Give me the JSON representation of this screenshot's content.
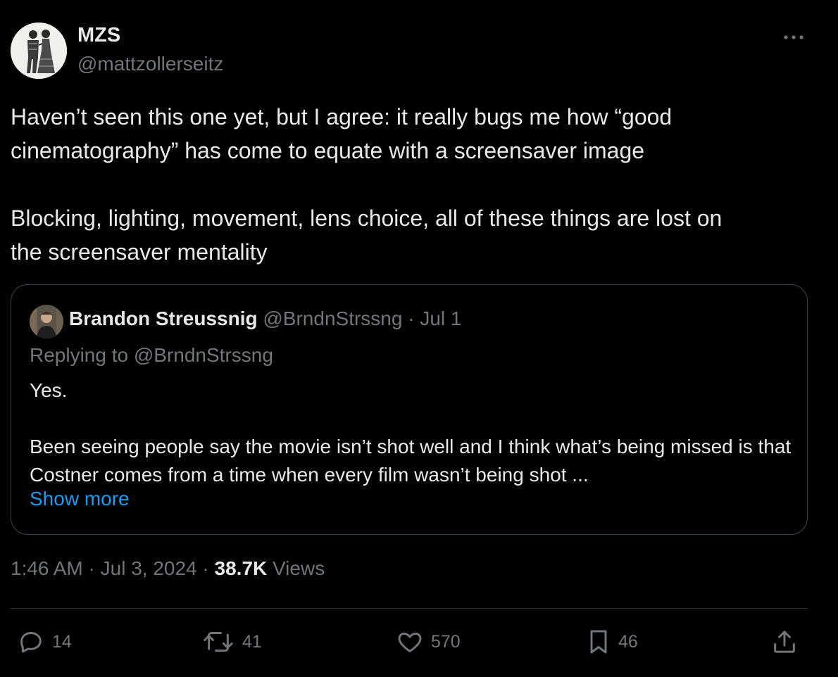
{
  "author": {
    "name": "MZS",
    "handle": "@mattzollerseitz"
  },
  "tweet": {
    "paragraphs": [
      "Haven’t seen this one yet, but I agree: it really bugs me how “good\ncinematography” has come to equate with a screensaver image",
      "Blocking, lighting, movement, lens choice, all of these things are lost on\nthe screensaver mentality"
    ]
  },
  "quoted": {
    "name": "Brandon Streussnig",
    "handle": "@BrndnStrssng",
    "separator": "·",
    "date": "Jul 1",
    "replying_to": "Replying to @BrndnStrssng",
    "paragraphs": [
      "Yes.",
      "Been seeing people say the movie isn’t shot well and I think what’s being missed is that Costner comes from a time when every film wasn’t being shot ..."
    ],
    "show_more": "Show more"
  },
  "meta": {
    "time": "1:46 AM",
    "separator": "·",
    "date": "Jul 3, 2024",
    "views_count": "38.7K",
    "views_label": "Views"
  },
  "actions": {
    "replies": "14",
    "reposts": "41",
    "likes": "570",
    "bookmarks": "46"
  },
  "colors": {
    "background": "#000000",
    "text": "#e7e9ea",
    "secondary": "#71767b",
    "link": "#1d9bf0",
    "border": "#38444d"
  },
  "icons": {
    "more": "more-horizontal-icon",
    "reply": "reply-icon",
    "repost": "repost-icon",
    "like": "heart-icon",
    "bookmark": "bookmark-icon",
    "share": "share-icon"
  }
}
